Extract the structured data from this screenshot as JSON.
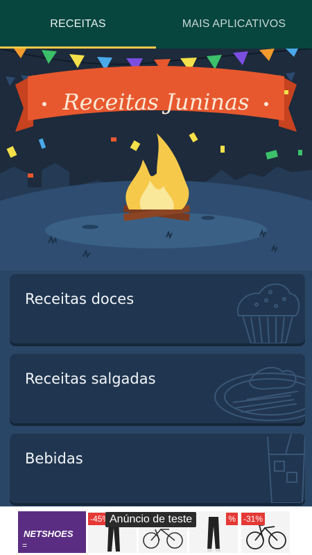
{
  "tabs": [
    {
      "label": "RECEITAS",
      "active": true
    },
    {
      "label": "MAIS APLICATIVOS",
      "active": false
    }
  ],
  "hero": {
    "banner_title": "Receitas Juninas"
  },
  "categories": [
    {
      "label": "Receitas doces",
      "icon": "cupcake-icon"
    },
    {
      "label": "Receitas salgadas",
      "icon": "savory-plate-icon"
    },
    {
      "label": "Bebidas",
      "icon": "drink-glass-icon"
    }
  ],
  "ad": {
    "brand": "NETSHOES",
    "notice": "Anúncio de teste",
    "products": [
      {
        "discount": "-45%"
      },
      {
        "discount": ""
      },
      {
        "discount": "%"
      },
      {
        "discount": "-31%"
      }
    ]
  },
  "colors": {
    "tabbar": "#07463f",
    "tab_indicator": "#f6c94a",
    "banner": "#e8582e",
    "card": "#203650",
    "brand_purple": "#5a2d82"
  }
}
